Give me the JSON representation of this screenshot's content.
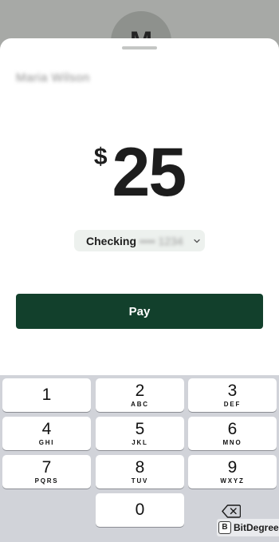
{
  "backdrop": {
    "avatar_initial": "M"
  },
  "payment": {
    "recipient_name": "Maria Wilson",
    "currency_symbol": "$",
    "amount": "25",
    "account_label": "Checking",
    "account_mask": "•••• 1234",
    "pay_button_label": "Pay"
  },
  "keypad": {
    "keys": [
      {
        "digit": "1",
        "letters": ""
      },
      {
        "digit": "2",
        "letters": "ABC"
      },
      {
        "digit": "3",
        "letters": "DEF"
      },
      {
        "digit": "4",
        "letters": "GHI"
      },
      {
        "digit": "5",
        "letters": "JKL"
      },
      {
        "digit": "6",
        "letters": "MNO"
      },
      {
        "digit": "7",
        "letters": "PQRS"
      },
      {
        "digit": "8",
        "letters": "TUV"
      },
      {
        "digit": "9",
        "letters": "WXYZ"
      },
      {
        "digit": "0",
        "letters": ""
      }
    ],
    "delete_icon": "backspace-icon"
  },
  "watermark": {
    "badge": "B",
    "text": "BitDegree"
  },
  "colors": {
    "accent": "#12402c",
    "backdrop": "#a7a9a6",
    "keypad_background": "#d1d3d9",
    "pill_background": "#edf1ee"
  }
}
